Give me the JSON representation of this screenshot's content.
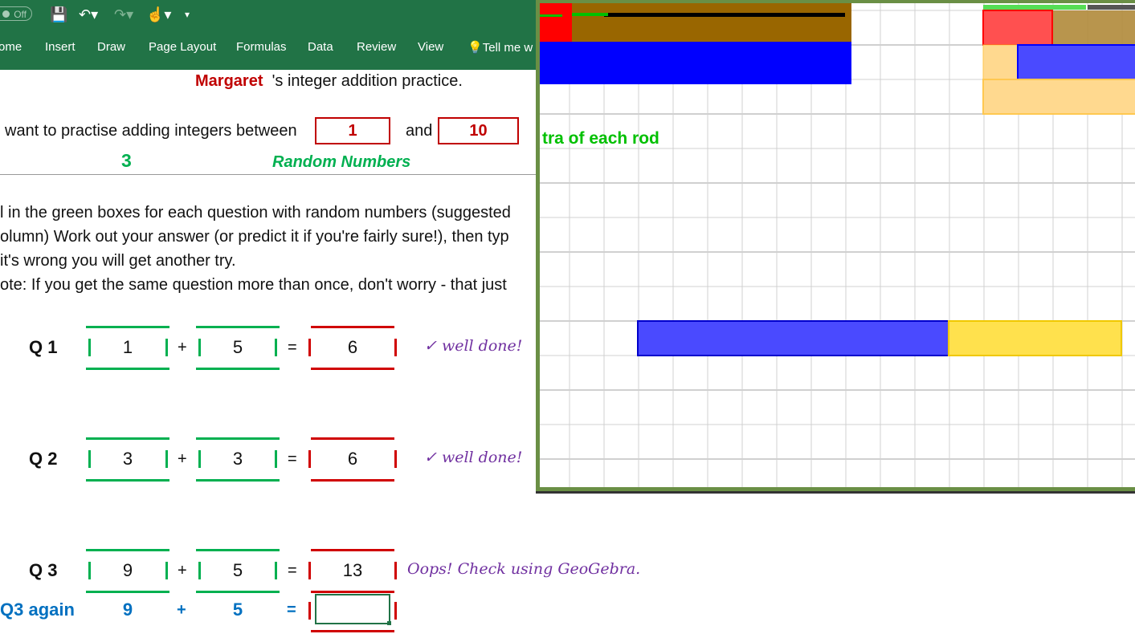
{
  "quick_access": {
    "autosave_label": "Off",
    "icons": [
      "save-icon",
      "undo-icon",
      "redo-icon",
      "touch-mode-icon",
      "customize-icon"
    ]
  },
  "ribbon": {
    "tabs": [
      "ome",
      "Insert",
      "Draw",
      "Page Layout",
      "Formulas",
      "Data",
      "Review",
      "View"
    ],
    "tell_me": "Tell me w"
  },
  "sheet": {
    "name": "Margaret",
    "title_suffix": "'s integer addition practice.",
    "range_prefix": "want to practise adding integers between",
    "range_min": "1",
    "range_and": "and",
    "range_max": "10",
    "count": "3",
    "random_label": "Random Numbers",
    "instructions": [
      "l in the green boxes for each question with random numbers (suggested",
      "olumn) Work out your answer (or predict it if you're fairly sure!), then typ",
      "it's wrong you will get another try.",
      "ote: If you get the same question more than once, don't worry - that just"
    ],
    "questions": [
      {
        "label": "Q 1",
        "a": "1",
        "b": "5",
        "answer": "6",
        "feedback": "✓ well done!"
      },
      {
        "label": "Q 2",
        "a": "3",
        "b": "3",
        "answer": "6",
        "feedback": "✓ well done!"
      },
      {
        "label": "Q 3",
        "a": "9",
        "b": "5",
        "answer": "13",
        "feedback": "Oops! Check using GeoGebra."
      }
    ],
    "plus": "+",
    "equals": "=",
    "retry": {
      "label": "Q3 again",
      "a": "9",
      "b": "5",
      "plus": "+",
      "equals": "=",
      "answer": ""
    }
  },
  "geogebra": {
    "caption": "tra of each rod",
    "colors": {
      "brown": "#996600",
      "blue": "#0000ff",
      "red": "#ff0000",
      "yellow": "#ffe14d",
      "orange_light": "#ffd98f",
      "border": "#6a8f45",
      "caption": "#00c000"
    }
  }
}
